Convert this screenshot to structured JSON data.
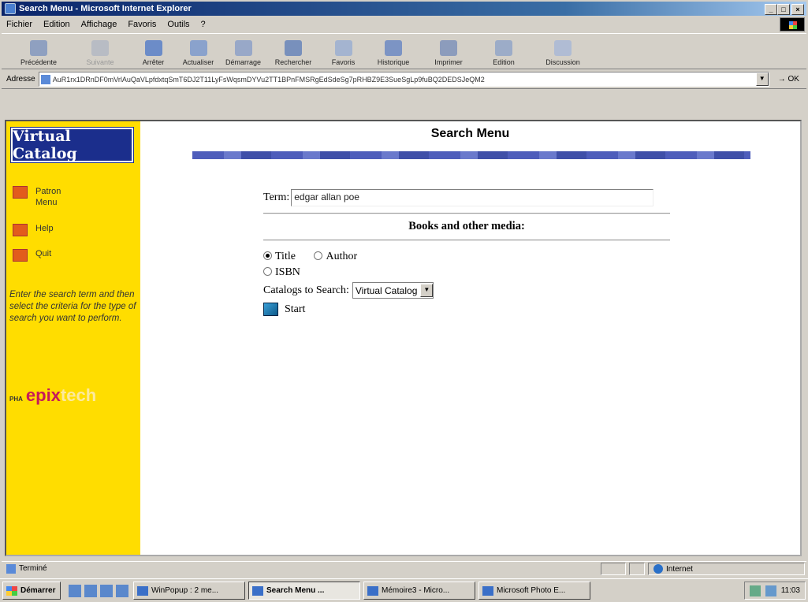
{
  "window": {
    "title": "Search Menu - Microsoft Internet Explorer"
  },
  "menu": [
    "Fichier",
    "Edition",
    "Affichage",
    "Favoris",
    "Outils",
    "?"
  ],
  "toolbar": [
    "Précédente",
    "Suivante",
    "Arrêter",
    "Actualiser",
    "Démarrage",
    "Rechercher",
    "Favoris",
    "Historique",
    "Imprimer",
    "Edition",
    "Discussion"
  ],
  "address": {
    "label": "Adresse",
    "value": "AuR1rx1DRnDF0mVrlAuQaVLpfdxtqSmT6DJ2T11LyFsWqsmDYVu2TT1BPnFMSRgEdSdeSg7pRHBZ9E3SueSgLp9fuBQ2DEDSJeQM2",
    "go": "OK"
  },
  "sidebar": {
    "logo": "Virtual Catalog",
    "items": [
      {
        "label": "Patron Menu"
      },
      {
        "label": "Help"
      },
      {
        "label": "Quit"
      }
    ],
    "instructions": "Enter the search term and then select the criteria for the type of search you want to perform.",
    "brand_pre": "PHA",
    "brand": "epix",
    "brand_tail": "tech"
  },
  "main": {
    "title": "Search Menu",
    "term_label": "Term:",
    "term_value": "edgar allan poe",
    "books_heading": "Books and other media:",
    "opt_title": "Title",
    "opt_author": "Author",
    "opt_isbn": "ISBN",
    "catalogs_label": "Catalogs to Search:",
    "catalog_selected": "Virtual Catalog",
    "start": "Start"
  },
  "status": {
    "left": "Terminé",
    "zone": "Internet"
  },
  "taskbar": {
    "start": "Démarrer",
    "items": [
      "WinPopup : 2 me...",
      "Search Menu ...",
      "Mémoire3 - Micro...",
      "Microsoft Photo E..."
    ],
    "clock": "11:03"
  }
}
